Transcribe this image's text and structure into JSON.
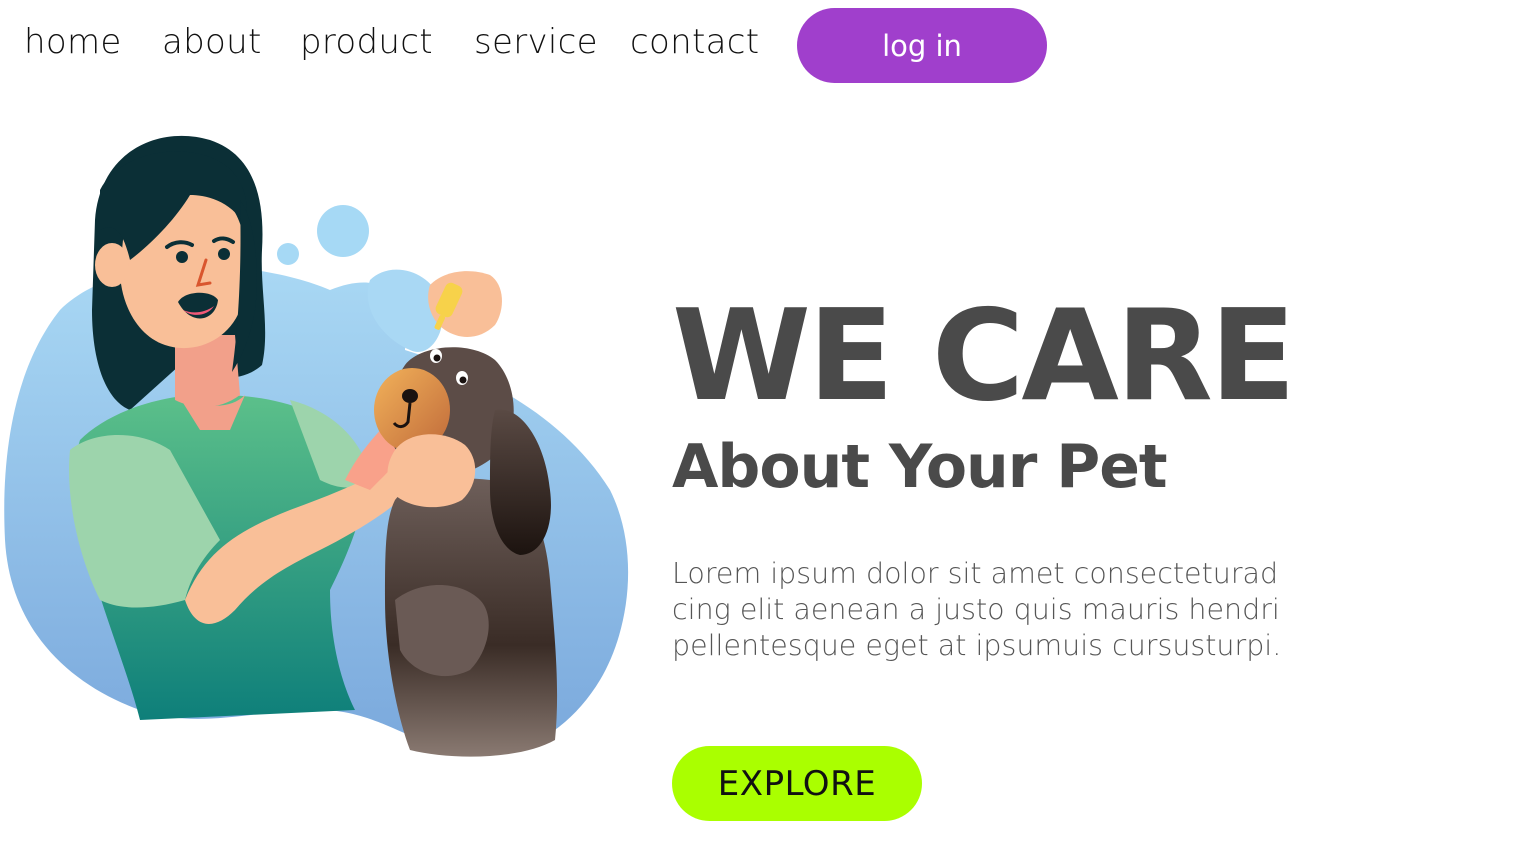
{
  "nav": {
    "links": [
      "home",
      "about",
      "product",
      "service",
      "contact"
    ],
    "login_label": "log in"
  },
  "hero": {
    "title": "WE CARE",
    "subtitle": "About Your Pet",
    "body_lines": [
      "Lorem ipsum dolor sit amet consecteturad",
      "cing elit aenean a justo quis mauris hendri",
      "pellentesque eget at ipsumuis cursusturpi."
    ],
    "cta_label": "EXPLORE"
  },
  "colors": {
    "login_button": "#a03fcc",
    "explore_button": "#aaff00",
    "heading_text": "#4a4a4a",
    "blob_blue": "#8fc4ec"
  },
  "illustration": {
    "icon": "woman-giving-eye-drops-to-dog-illustration"
  }
}
